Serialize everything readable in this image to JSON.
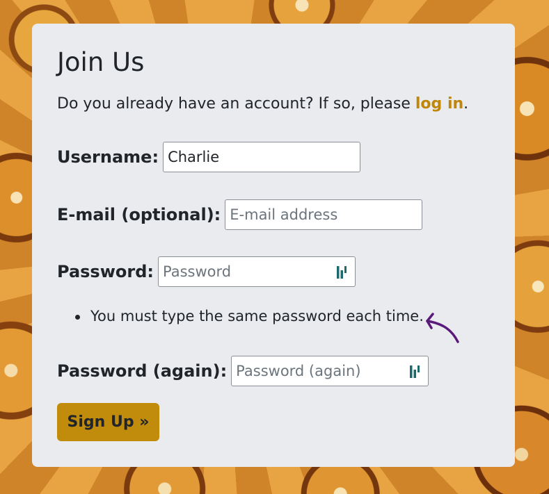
{
  "form": {
    "title": "Join Us",
    "intro_prefix": "Do you already have an account? If so, please ",
    "login_link": "log in",
    "intro_suffix": ".",
    "username_label": "Username:",
    "username_value": "Charlie",
    "email_label": "E-mail (optional):",
    "email_placeholder": "E-mail address",
    "password_label": "Password:",
    "password_placeholder": "Password",
    "password_hint": "You must type the same password each time.",
    "password_again_label": "Password (again):",
    "password_again_placeholder": "Password (again)",
    "submit_label": "Sign Up »"
  },
  "icons": {
    "password_manager": "password-manager-icon",
    "annotation": "curved-arrow-icon"
  },
  "colors": {
    "card_bg": "#e9ebef",
    "link": "#bf8608",
    "button": "#c18b0c",
    "annotation_arrow": "#5a1a7a",
    "pw_icon": "#1d6a6e"
  }
}
